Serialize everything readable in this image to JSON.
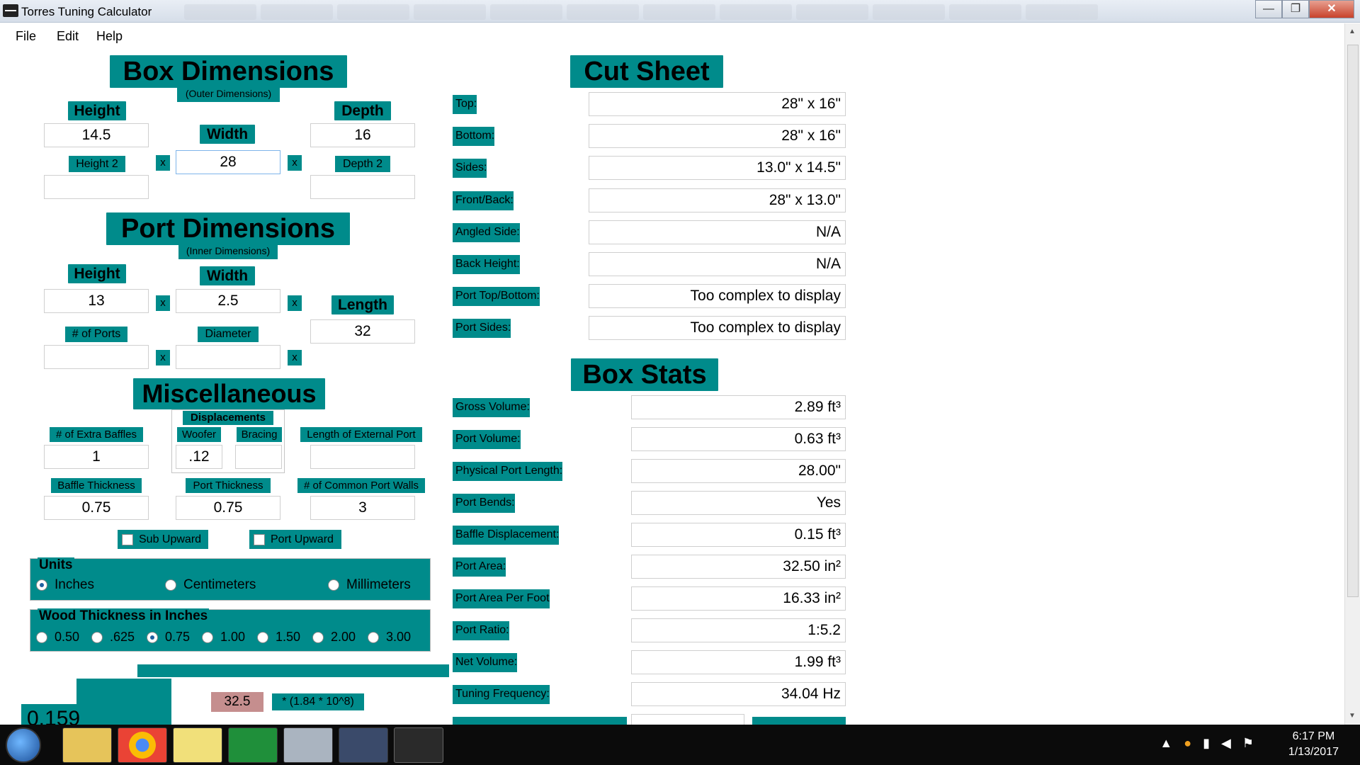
{
  "window": {
    "title": "Torres Tuning Calculator",
    "min": "—",
    "max": "❐",
    "close": "✕"
  },
  "menu": [
    "File",
    "Edit",
    "Help"
  ],
  "box_dimensions": {
    "title": "Box Dimensions",
    "subtitle": "(Outer Dimensions)",
    "height_label": "Height",
    "height_value": "14.5",
    "width_label": "Width",
    "width_value": "28",
    "depth_label": "Depth",
    "depth_value": "16",
    "height2_label": "Height 2",
    "height2_value": "",
    "depth2_label": "Depth 2",
    "depth2_value": ""
  },
  "port_dimensions": {
    "title": "Port Dimensions",
    "subtitle": "(Inner Dimensions)",
    "height_label": "Height",
    "height_value": "13",
    "width_label": "Width",
    "width_value": "2.5",
    "length_label": "Length",
    "length_value": "32",
    "num_ports_label": "# of Ports",
    "num_ports_value": "",
    "diameter_label": "Diameter",
    "diameter_value": ""
  },
  "x": "x",
  "misc": {
    "title": "Miscellaneous",
    "displacements_label": "Displacements",
    "extra_baffles_label": "# of Extra Baffles",
    "extra_baffles_value": "1",
    "woofer_label": "Woofer",
    "woofer_value": ".12",
    "bracing_label": "Bracing",
    "bracing_value": "",
    "ext_port_label": "Length of External Port",
    "ext_port_value": "",
    "baffle_thickness_label": "Baffle Thickness",
    "baffle_thickness_value": "0.75",
    "port_thickness_label": "Port Thickness",
    "port_thickness_value": "0.75",
    "common_walls_label": "# of Common Port Walls",
    "common_walls_value": "3",
    "sub_upward_label": "Sub Upward",
    "port_upward_label": "Port Upward"
  },
  "units": {
    "title": "Units",
    "options": [
      "Inches",
      "Centimeters",
      "Millimeters"
    ],
    "selected": "Inches"
  },
  "wood": {
    "title": "Wood Thickness in Inches",
    "options": [
      "0.50",
      ".625",
      "0.75",
      "1.00",
      "1.50",
      "2.00",
      "3.00"
    ],
    "selected": "0.75"
  },
  "bottom_calc": {
    "value": "0.159",
    "input": "32.5",
    "formula": "* (1.84 * 10^8)"
  },
  "cut_sheet": {
    "title": "Cut Sheet",
    "rows": [
      {
        "label": "Top:",
        "value": "28\" x 16\""
      },
      {
        "label": "Bottom:",
        "value": "28\" x 16\""
      },
      {
        "label": "Sides:",
        "value": "13.0\" x 14.5\""
      },
      {
        "label": "Front/Back:",
        "value": "28\" x 13.0\""
      },
      {
        "label": "Angled Side:",
        "value": "N/A"
      },
      {
        "label": "Back Height:",
        "value": "N/A"
      },
      {
        "label": "Port Top/Bottom:",
        "value": "Too complex to display"
      },
      {
        "label": "Port Sides:",
        "value": "Too complex to display"
      }
    ]
  },
  "box_stats": {
    "title": "Box Stats",
    "rows": [
      {
        "label": "Gross Volume:",
        "value": "2.89 ft³"
      },
      {
        "label": "Port Volume:",
        "value": "0.63 ft³"
      },
      {
        "label": "Physical Port Length:",
        "value": "28.00\""
      },
      {
        "label": "Port Bends:",
        "value": "Yes"
      },
      {
        "label": "Baffle Displacement:",
        "value": "0.15 ft³"
      },
      {
        "label": "Port Area:",
        "value": "32.50 in²"
      },
      {
        "label": "Port Area Per Foot",
        "value": "16.33 in²"
      },
      {
        "label": "Port Ratio:",
        "value": "1:5.2"
      },
      {
        "label": "Net Volume:",
        "value": "1.99 ft³"
      },
      {
        "label": "Tuning Frequency:",
        "value": "34.04 Hz"
      }
    ]
  },
  "taskbar": {
    "time": "6:17 PM",
    "date": "1/13/2017"
  }
}
